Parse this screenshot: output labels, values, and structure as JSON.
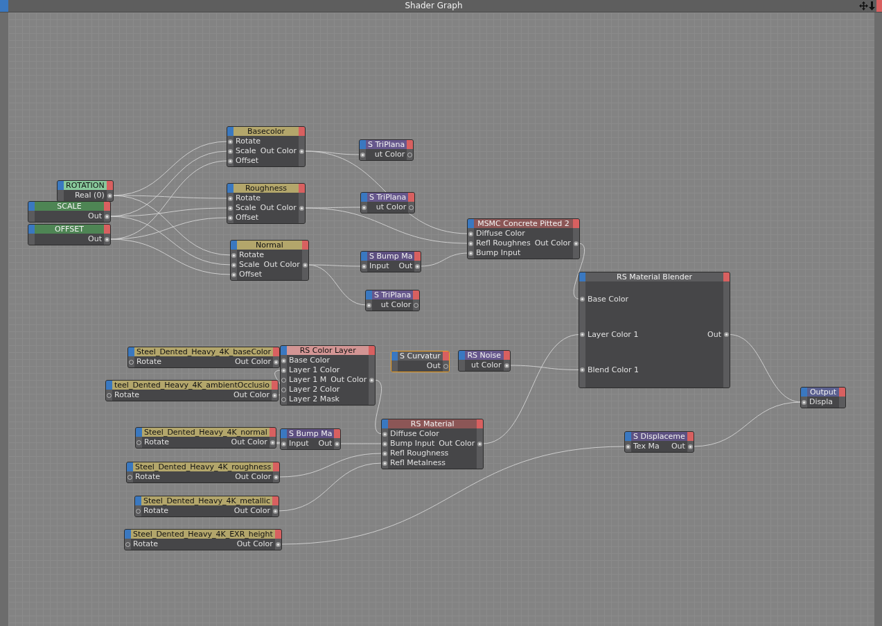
{
  "window": {
    "title": "Shader Graph"
  },
  "nodes": [
    {
      "title": "Basecolor",
      "color": "#b3a66b",
      "selected": false,
      "rows": [
        {
          "in_label": "Rotate",
          "in_linked": true
        },
        {
          "in_label": "Scale",
          "in_linked": true,
          "out_label": "Out Color",
          "out_linked": true
        },
        {
          "in_label": "Offset",
          "in_linked": true
        }
      ]
    },
    {
      "title": "S TriPlana",
      "color": "#66578c",
      "selected": false,
      "rows": [
        {
          "in_linked": true,
          "out_label": "ut Color",
          "out_linked": false
        }
      ]
    },
    {
      "title": "ROTATION",
      "color": "#88c99b",
      "selected": false,
      "rows": [
        {
          "out_label": "Real (0)",
          "out_linked": true
        }
      ]
    },
    {
      "title": "SCALE",
      "color": "#4e8554",
      "selected": false,
      "rows": [
        {
          "out_label": "Out",
          "out_linked": true
        }
      ]
    },
    {
      "title": "OFFSET",
      "color": "#4e8554",
      "selected": false,
      "rows": [
        {
          "out_label": "Out",
          "out_linked": true
        }
      ]
    },
    {
      "title": "Roughness",
      "color": "#b3a66b",
      "selected": false,
      "rows": [
        {
          "in_label": "Rotate",
          "in_linked": true
        },
        {
          "in_label": "Scale",
          "in_linked": true,
          "out_label": "Out Color",
          "out_linked": true
        },
        {
          "in_label": "Offset",
          "in_linked": true
        }
      ]
    },
    {
      "title": "S TriPlana",
      "color": "#66578c",
      "selected": false,
      "rows": [
        {
          "in_linked": true,
          "out_label": "ut Color",
          "out_linked": false
        }
      ]
    },
    {
      "title": "MSMC Concrete Pitted 2",
      "color": "#8c5656",
      "selected": false,
      "rows": [
        {
          "in_label": "Diffuse Color",
          "in_linked": true
        },
        {
          "in_label": "Refl Roughnes",
          "in_linked": true,
          "out_label": "Out Color",
          "out_linked": true
        },
        {
          "in_label": "Bump Input",
          "in_linked": true
        }
      ]
    },
    {
      "title": "Normal",
      "color": "#b3a66b",
      "selected": false,
      "rows": [
        {
          "in_label": "Rotate",
          "in_linked": true
        },
        {
          "in_label": "Scale",
          "in_linked": true,
          "out_label": "Out Color",
          "out_linked": true
        },
        {
          "in_label": "Offset",
          "in_linked": true
        }
      ]
    },
    {
      "title": "S Bump Ma",
      "color": "#5d4f80",
      "selected": false,
      "rows": [
        {
          "in_label": "Input",
          "in_linked": true,
          "out_label": "Out",
          "out_linked": true
        }
      ]
    },
    {
      "title": "S TriPlana",
      "color": "#66578c",
      "selected": false,
      "rows": [
        {
          "in_linked": true,
          "out_label": "ut Color",
          "out_linked": false
        }
      ]
    },
    {
      "title": "RS Material Blender",
      "color": "#5c5c5e",
      "selected": false,
      "rows": [
        {
          "in_label": "Base Color",
          "in_linked": true
        },
        {
          "in_label": "Layer Color 1",
          "in_linked": true,
          "out_label": "Out",
          "out_linked": true
        },
        {
          "in_label": "Blend Color 1",
          "in_linked": true
        }
      ]
    },
    {
      "title": "Steel_Dented_Heavy_4K_baseColor",
      "color": "#b3a66b",
      "selected": false,
      "rows": [
        {
          "in_label": "Rotate",
          "in_linked": false,
          "out_label": "Out Color",
          "out_linked": true
        }
      ]
    },
    {
      "title": "RS Color Layer",
      "color": "#d39594",
      "selected": false,
      "rows": [
        {
          "in_label": "Base Color",
          "in_linked": true
        },
        {
          "in_label": "Layer 1 Color",
          "in_linked": true
        },
        {
          "in_label": "Layer 1 M",
          "in_linked": false,
          "out_label": "Out Color",
          "out_linked": true
        },
        {
          "in_label": "Layer 2 Color",
          "in_linked": false
        },
        {
          "in_label": "Layer 2 Mask",
          "in_linked": false
        }
      ]
    },
    {
      "title": "S Curvatur",
      "color": "#5c5c5e",
      "selected": true,
      "rows": [
        {
          "out_label": "Out",
          "out_linked": false
        }
      ]
    },
    {
      "title": "RS Noise",
      "color": "#66578c",
      "selected": false,
      "rows": [
        {
          "out_label": "ut Color",
          "out_linked": true
        }
      ]
    },
    {
      "title": "teel_Dented_Heavy_4K_ambientOcclusio",
      "color": "#b3a66b",
      "selected": false,
      "rows": [
        {
          "in_label": "Rotate",
          "in_linked": false,
          "out_label": "Out Color",
          "out_linked": true
        }
      ]
    },
    {
      "title": "Output",
      "color": "#5a5f8f",
      "selected": false,
      "rows": [
        {
          "in_label": "Displa",
          "in_linked": true
        }
      ]
    },
    {
      "title": "Steel_Dented_Heavy_4K_normal",
      "color": "#b3a66b",
      "selected": false,
      "rows": [
        {
          "in_label": "Rotate",
          "in_linked": false,
          "out_label": "Out Color",
          "out_linked": true
        }
      ]
    },
    {
      "title": "S Bump Ma",
      "color": "#5d4f80",
      "selected": false,
      "rows": [
        {
          "in_label": "Input",
          "in_linked": true,
          "out_label": "Out",
          "out_linked": true
        }
      ]
    },
    {
      "title": "RS Material",
      "color": "#8c5656",
      "selected": false,
      "rows": [
        {
          "in_label": "Diffuse Color",
          "in_linked": true
        },
        {
          "in_label": "Bump Input",
          "in_linked": true,
          "out_label": "Out Color",
          "out_linked": true
        },
        {
          "in_label": "Refl Roughness",
          "in_linked": true
        },
        {
          "in_label": "Refl Metalness",
          "in_linked": true
        }
      ]
    },
    {
      "title": "S Displaceme",
      "color": "#5e5282",
      "selected": false,
      "rows": [
        {
          "in_label": "Tex Ma",
          "in_linked": true,
          "out_label": "Out",
          "out_linked": true
        }
      ]
    },
    {
      "title": "Steel_Dented_Heavy_4K_roughness",
      "color": "#b3a66b",
      "selected": false,
      "rows": [
        {
          "in_label": "Rotate",
          "in_linked": false,
          "out_label": "Out Color",
          "out_linked": true
        }
      ]
    },
    {
      "title": "Steel_Dented_Heavy_4K_metallic",
      "color": "#b3a66b",
      "selected": false,
      "rows": [
        {
          "in_label": "Rotate",
          "in_linked": false,
          "out_label": "Out Color",
          "out_linked": true
        }
      ]
    },
    {
      "title": "Steel_Dented_Heavy_4K_EXR_height",
      "color": "#b3a66b",
      "selected": false,
      "rows": [
        {
          "in_label": "Rotate",
          "in_linked": false,
          "out_label": "Out Color",
          "out_linked": true
        }
      ]
    }
  ]
}
